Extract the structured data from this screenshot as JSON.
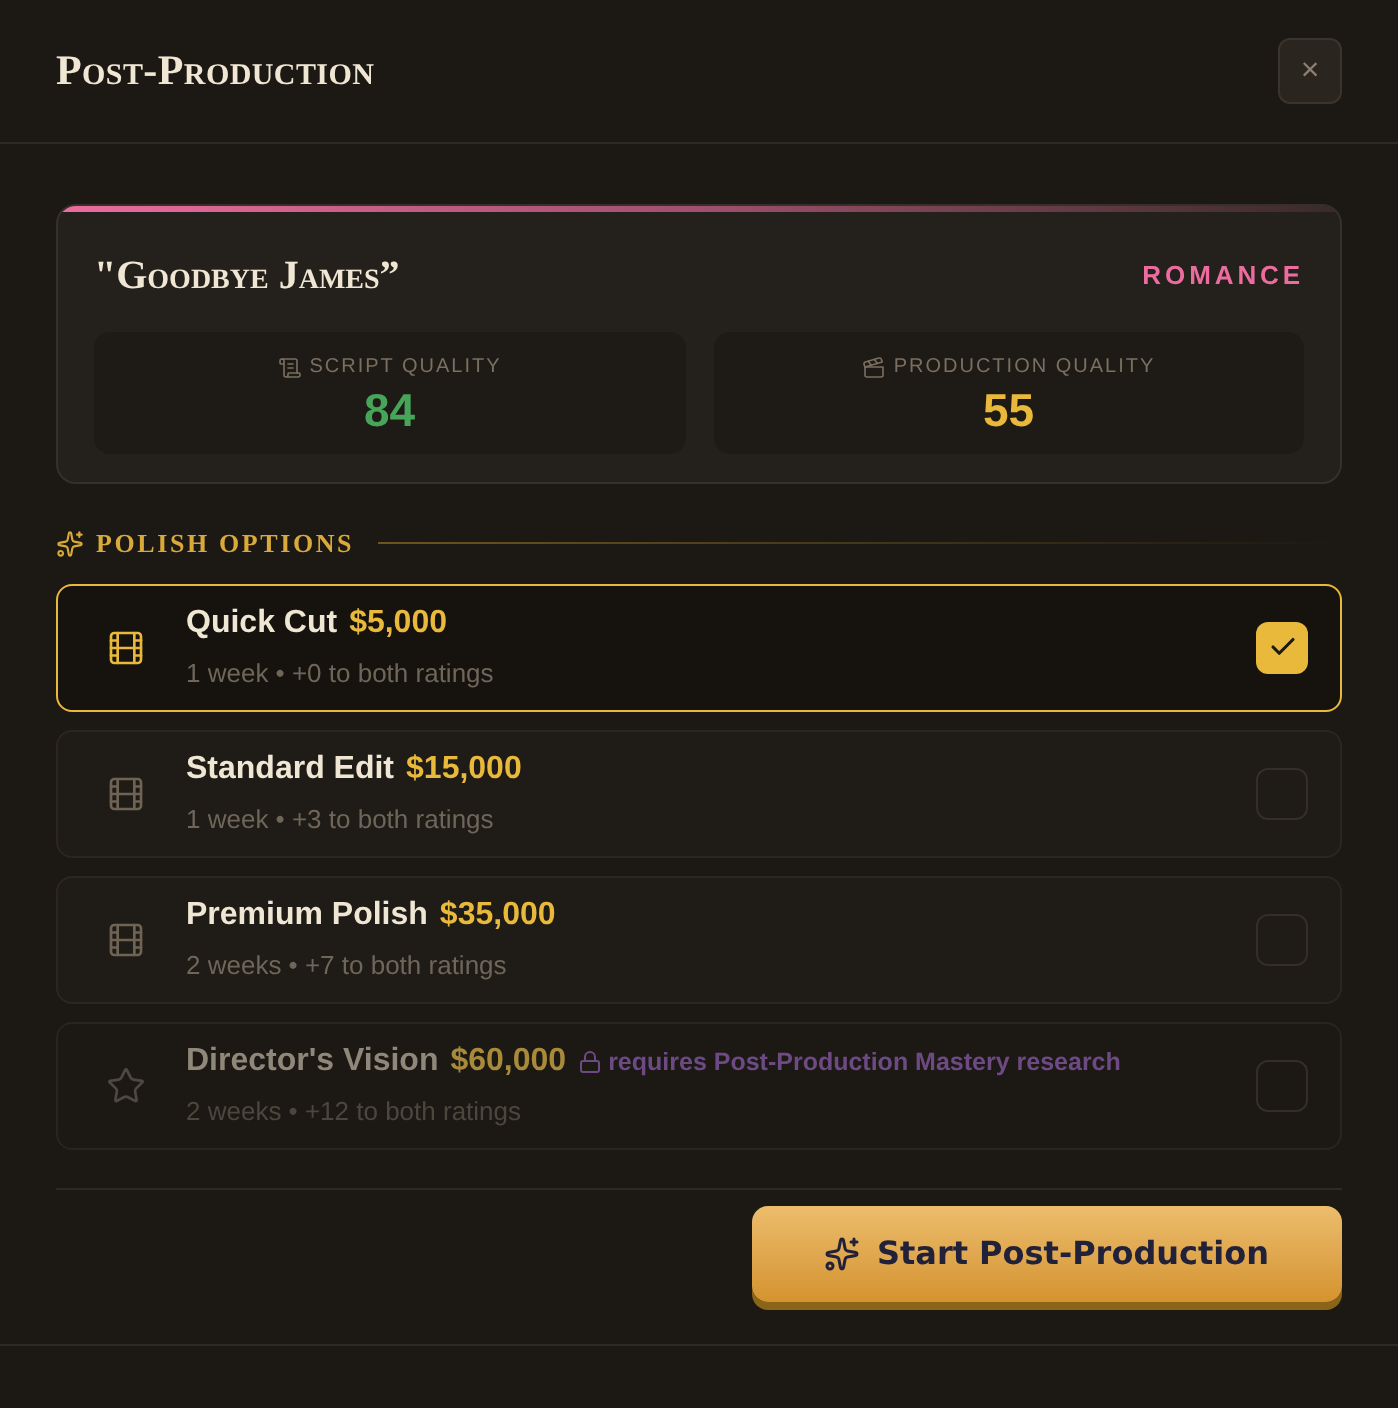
{
  "dialog": {
    "title": "Post-Production",
    "close_label": "×"
  },
  "film": {
    "title": "\"Goodbye James”",
    "genre": "ROMANCE",
    "stats": [
      {
        "kind": "script",
        "label": "SCRIPT QUALITY",
        "value": "84",
        "color": "#47a559"
      },
      {
        "kind": "production",
        "label": "PRODUCTION QUALITY",
        "value": "55",
        "color": "#e8b93a"
      }
    ]
  },
  "polish_options": {
    "heading": "POLISH OPTIONS",
    "options": [
      {
        "kind": "film",
        "name": "Quick Cut",
        "price": "$5,000",
        "details": "1 week • +0 to both ratings",
        "selected": true,
        "disabled": false
      },
      {
        "kind": "film",
        "name": "Standard Edit",
        "price": "$15,000",
        "details": "1 week • +3 to both ratings",
        "selected": false,
        "disabled": false
      },
      {
        "kind": "film",
        "name": "Premium Polish",
        "price": "$35,000",
        "details": "2 weeks • +7 to both ratings",
        "selected": false,
        "disabled": false
      },
      {
        "kind": "star",
        "name": "Director's Vision",
        "price": "$60,000",
        "requirement": "requires Post-Production Mastery research",
        "details": "2 weeks • +12 to both ratings",
        "selected": false,
        "disabled": true
      }
    ]
  },
  "start_button": {
    "label": "Start Post-Production"
  }
}
